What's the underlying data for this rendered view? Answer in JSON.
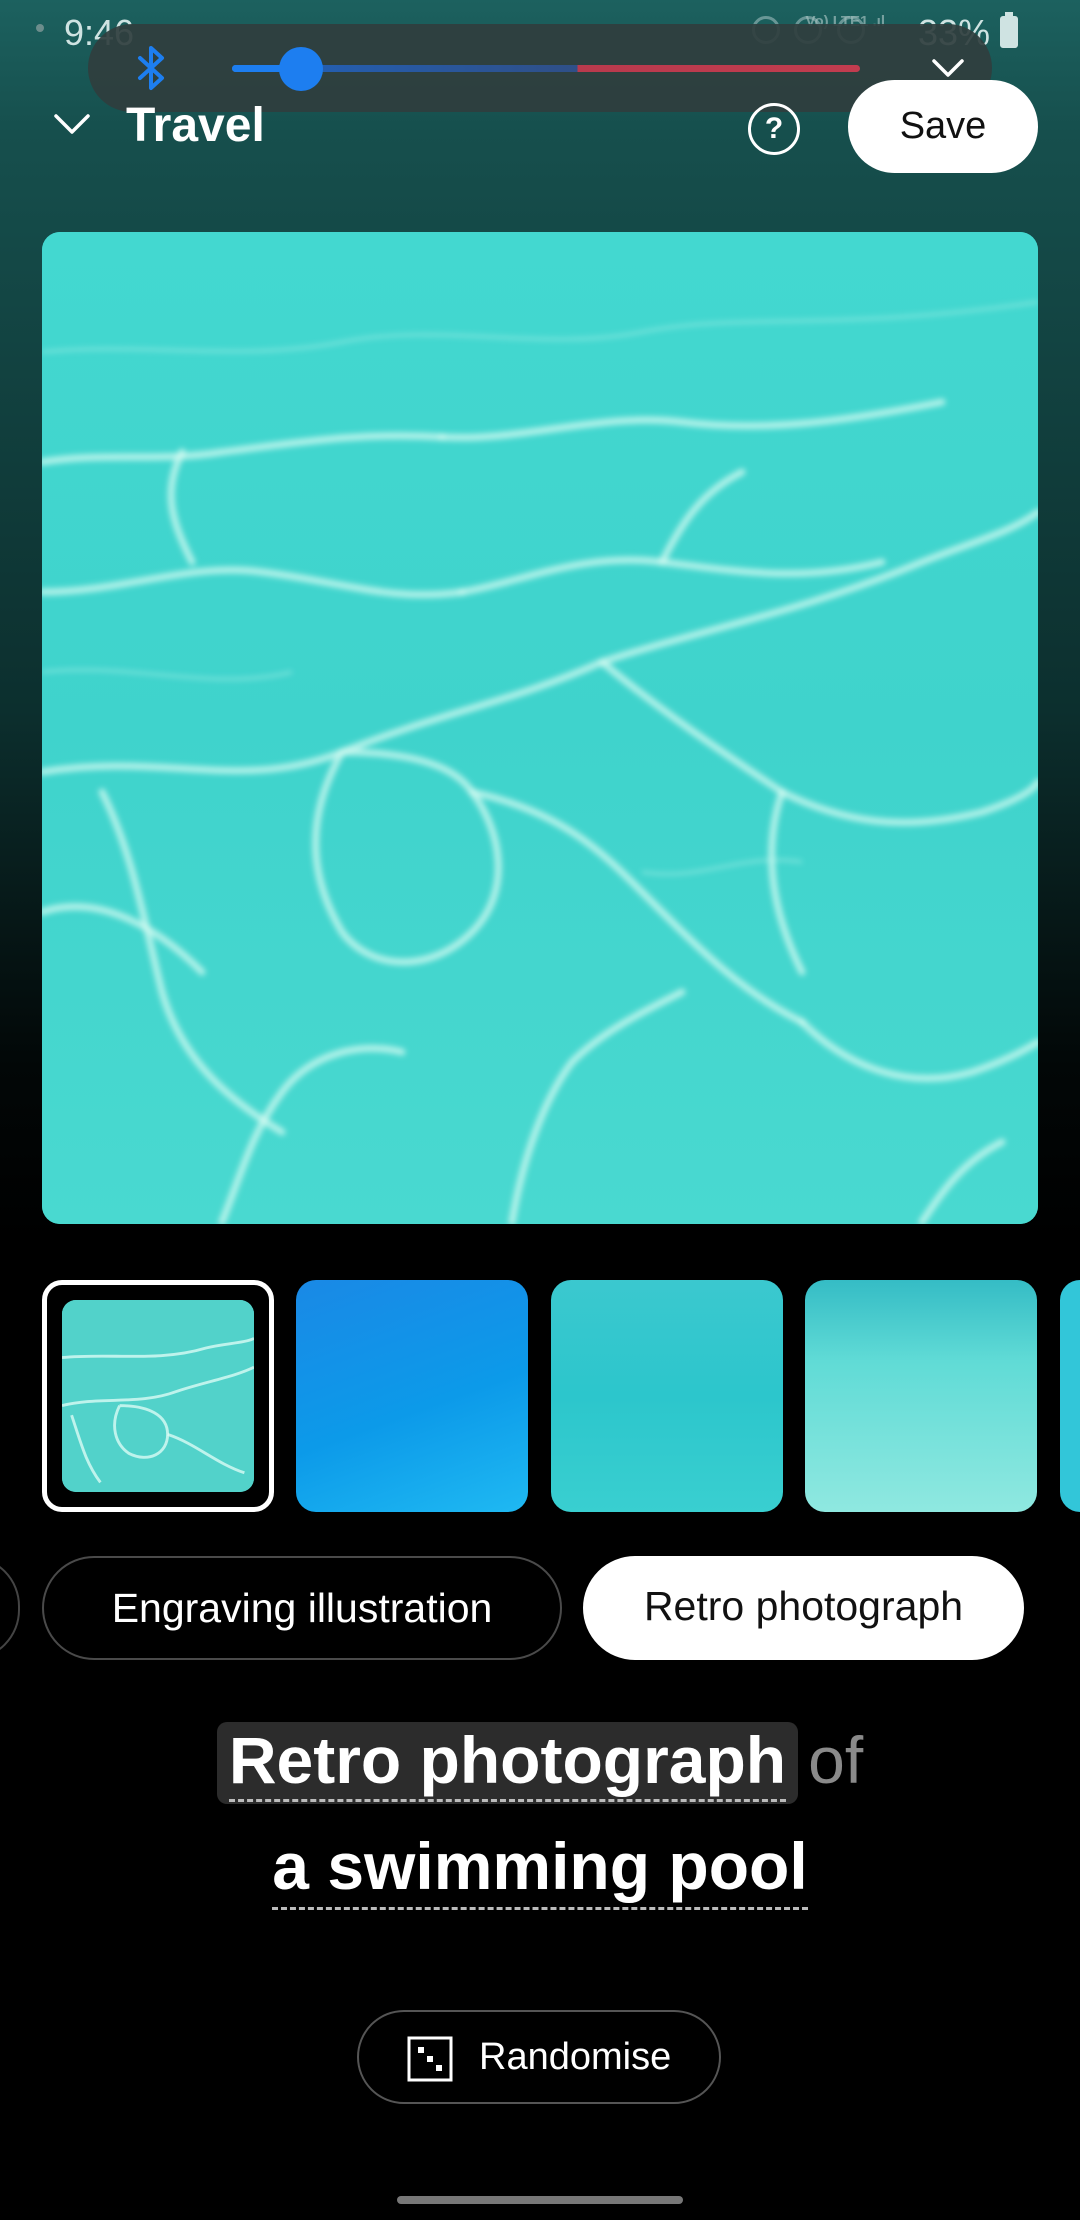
{
  "status_bar": {
    "time": "9:46",
    "battery_text": "33%",
    "network_text": "Vo) LTE1 .ıl"
  },
  "volume_panel": {
    "icon": "bluetooth-icon",
    "volume_level": 0.11,
    "accent_color": "#1d7ef0",
    "collapse_icon": "chevron-down-icon"
  },
  "header": {
    "back_icon": "chevron-down-icon",
    "title": "Travel",
    "help_label": "?",
    "save_label": "Save"
  },
  "preview": {
    "description_icon": "pool-water-image"
  },
  "thumbnails": {
    "count_visible": 5,
    "selected_index": 0
  },
  "styles": {
    "items": [
      {
        "label": ""
      },
      {
        "label": "Engraving illustration"
      },
      {
        "label": "Retro photograph"
      }
    ],
    "selected_index": 2
  },
  "prompt": {
    "style": "Retro photograph",
    "connector": "of",
    "subject": "a swimming pool"
  },
  "randomise": {
    "label": "Randomise",
    "icon": "dice-icon"
  }
}
